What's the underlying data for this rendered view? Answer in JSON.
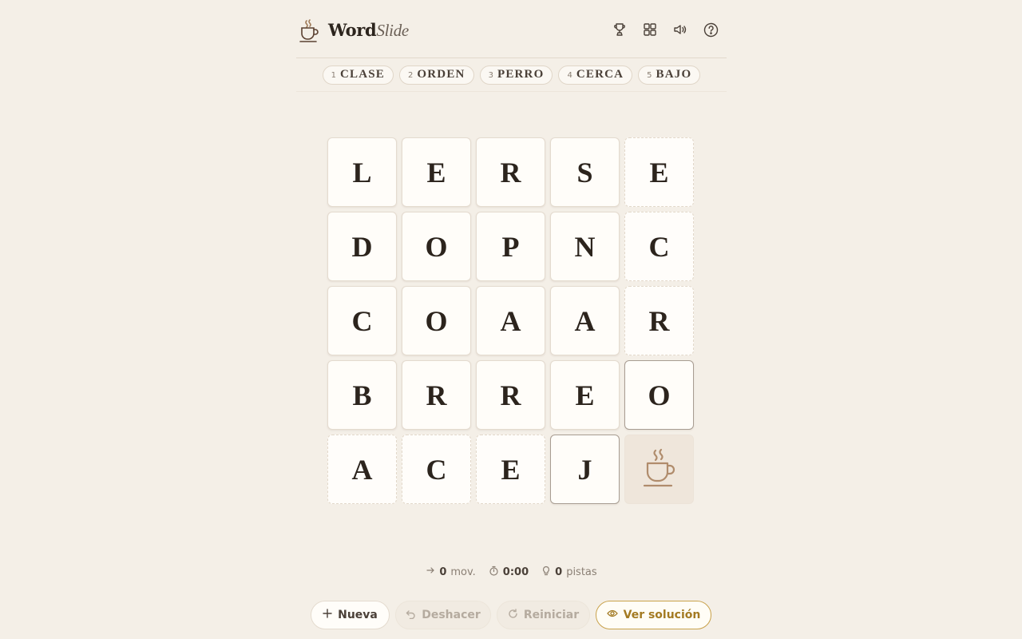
{
  "app": {
    "brand_bold": "Word",
    "brand_italic": "Slide",
    "logo_icon": "coffee-cup-icon",
    "header_icons": [
      "trophy-icon",
      "grid-icon",
      "sound-icon",
      "help-icon"
    ]
  },
  "words": [
    {
      "num": "1",
      "word": "CLASE"
    },
    {
      "num": "2",
      "word": "ORDEN"
    },
    {
      "num": "3",
      "word": "PERRO"
    },
    {
      "num": "4",
      "word": "CERCA"
    },
    {
      "num": "5",
      "word": "BAJO"
    }
  ],
  "board": {
    "rows": [
      [
        "L",
        "E",
        "R",
        "S",
        "E"
      ],
      [
        "D",
        "O",
        "P",
        "N",
        "C"
      ],
      [
        "C",
        "O",
        "A",
        "A",
        "R"
      ],
      [
        "B",
        "R",
        "R",
        "E",
        "O"
      ],
      [
        "A",
        "C",
        "E",
        "J",
        ""
      ]
    ],
    "empty_cell_icon": "coffee-cup-icon"
  },
  "stats": {
    "moves_value": "0",
    "moves_label": "mov.",
    "time_value": "0:00",
    "hints_value": "0",
    "hints_label": "pistas"
  },
  "actions": {
    "new_label": "Nueva",
    "undo_label": "Deshacer",
    "reset_label": "Reiniciar",
    "solution_label": "Ver solución"
  },
  "colors": {
    "background": "#f4efe7",
    "accent": "#a37a22",
    "icon": "#a07c5a"
  }
}
